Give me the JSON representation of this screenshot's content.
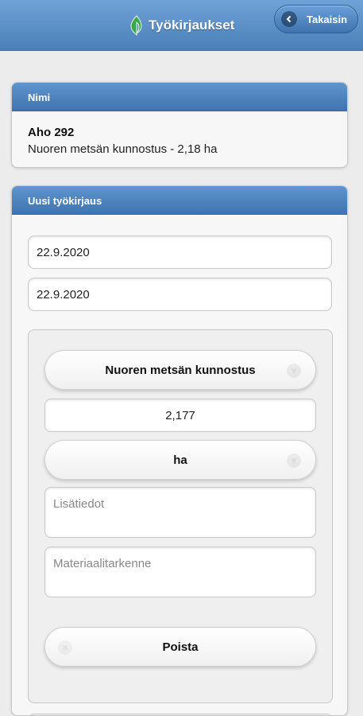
{
  "header": {
    "title": "Työkirjaukset",
    "back_label": "Takaisin"
  },
  "name_panel": {
    "heading": "Nimi",
    "name": "Aho 292",
    "detail": "Nuoren metsän kunnostus - 2,18 ha"
  },
  "new_entry": {
    "heading": "Uusi työkirjaus",
    "start_date": "22.9.2020",
    "end_date": "22.9.2020",
    "work_type": "Nuoren metsän kunnostus",
    "quantity": "2,177",
    "unit": "ha",
    "additional_info_placeholder": "Lisätiedot",
    "material_placeholder": "Materiaalitarkenne",
    "delete_label": "Poista"
  },
  "colors": {
    "header_blue": "#4a7fb8",
    "logo_green": "#3aa84a"
  }
}
